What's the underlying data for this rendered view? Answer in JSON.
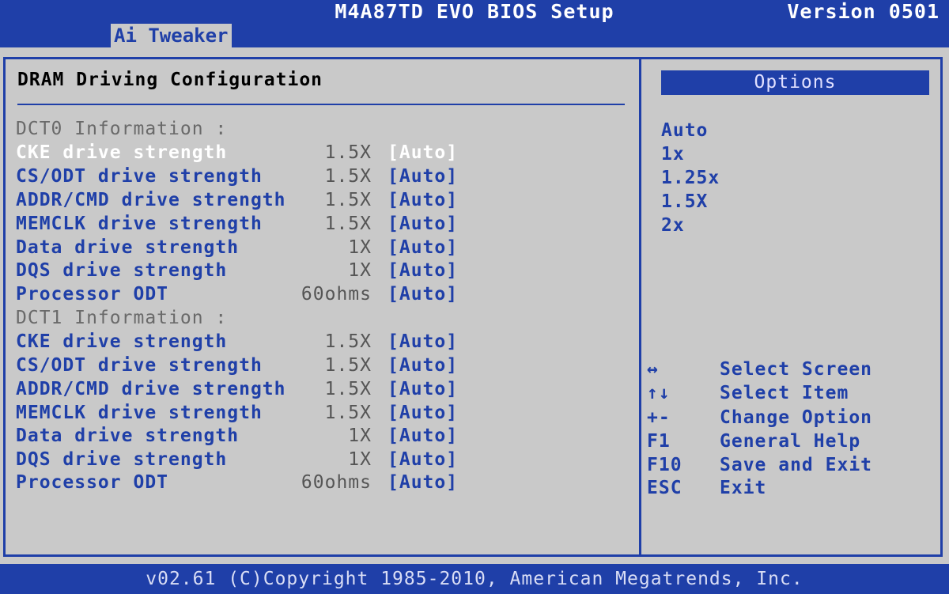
{
  "header": {
    "title": "M4A87TD EVO BIOS Setup",
    "version": "Version 0501"
  },
  "menu": {
    "active_tab": "Ai Tweaker"
  },
  "main": {
    "section_title": "DRAM Driving Configuration",
    "dct0_header": "DCT0 Information :",
    "dct0": [
      {
        "label": "CKE drive strength",
        "value": "1.5X",
        "setting": "[Auto]"
      },
      {
        "label": "CS/ODT drive strength",
        "value": "1.5X",
        "setting": "[Auto]"
      },
      {
        "label": "ADDR/CMD drive strength",
        "value": "1.5X",
        "setting": "[Auto]"
      },
      {
        "label": "MEMCLK drive strength",
        "value": "1.5X",
        "setting": "[Auto]"
      },
      {
        "label": "Data drive strength",
        "value": "1X",
        "setting": "[Auto]"
      },
      {
        "label": "DQS drive strength",
        "value": "1X",
        "setting": "[Auto]"
      },
      {
        "label": "Processor ODT",
        "value": "60ohms",
        "setting": "[Auto]"
      }
    ],
    "dct1_header": "DCT1 Information :",
    "dct1": [
      {
        "label": "CKE drive strength",
        "value": "1.5X",
        "setting": "[Auto]"
      },
      {
        "label": "CS/ODT drive strength",
        "value": "1.5X",
        "setting": "[Auto]"
      },
      {
        "label": "ADDR/CMD drive strength",
        "value": "1.5X",
        "setting": "[Auto]"
      },
      {
        "label": "MEMCLK drive strength",
        "value": "1.5X",
        "setting": "[Auto]"
      },
      {
        "label": "Data drive strength",
        "value": "1X",
        "setting": "[Auto]"
      },
      {
        "label": "DQS drive strength",
        "value": "1X",
        "setting": "[Auto]"
      },
      {
        "label": "Processor ODT",
        "value": "60ohms",
        "setting": "[Auto]"
      }
    ]
  },
  "options": {
    "header": "Options",
    "items": [
      "Auto",
      "1x",
      "1.25x",
      "1.5X",
      "2x"
    ]
  },
  "help": [
    {
      "key": "↔",
      "desc": "Select Screen"
    },
    {
      "key": "↑↓",
      "desc": "Select Item"
    },
    {
      "key": "+-",
      "desc": "Change Option"
    },
    {
      "key": "F1",
      "desc": "General Help"
    },
    {
      "key": "F10",
      "desc": "Save and Exit"
    },
    {
      "key": "ESC",
      "desc": "Exit"
    }
  ],
  "footer": {
    "copyright": "v02.61 (C)Copyright 1985-2010, American Megatrends, Inc."
  },
  "colors": {
    "accent": "#1f3fa8",
    "background": "#c9c9c9",
    "selected": "#ffffff"
  }
}
